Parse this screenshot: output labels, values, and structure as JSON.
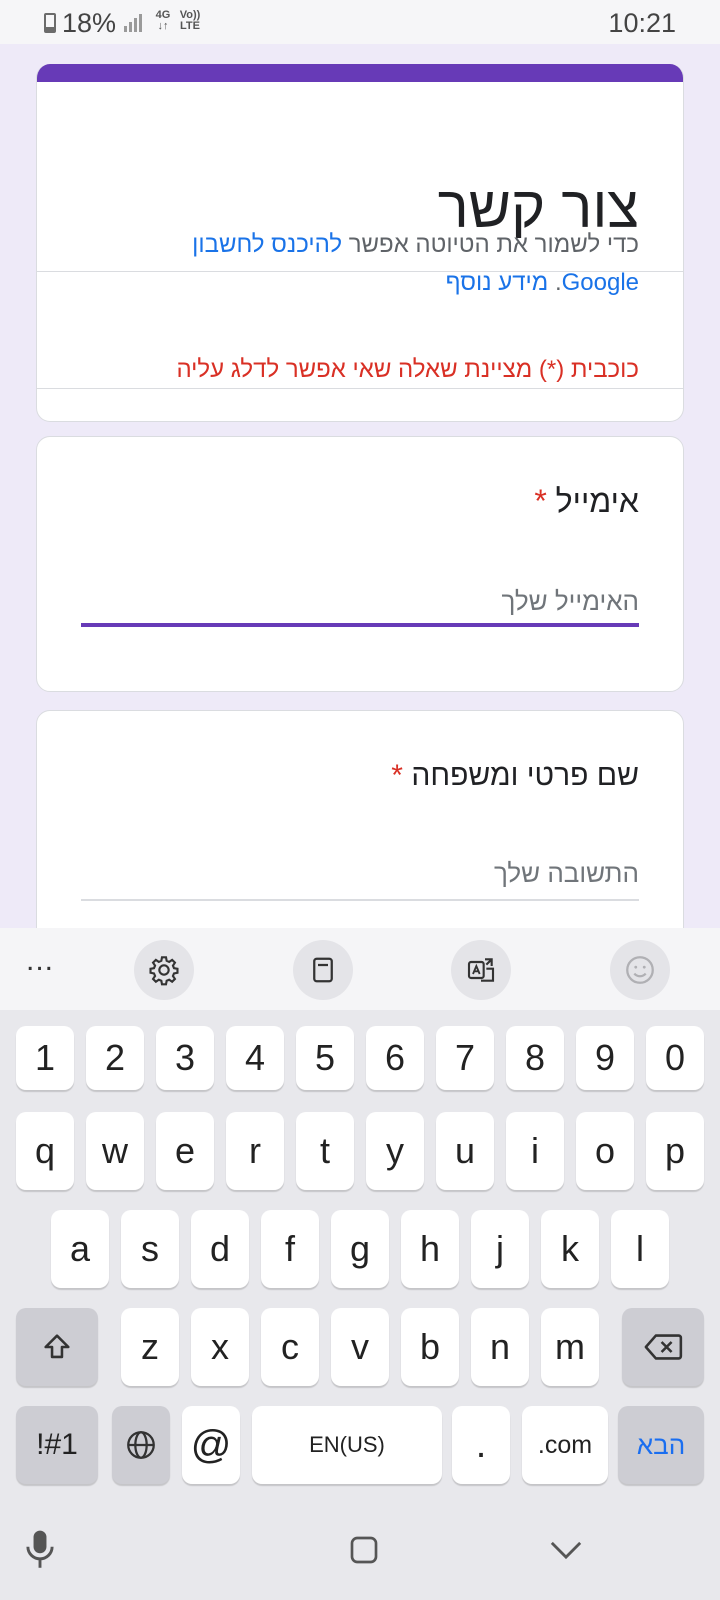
{
  "status_bar": {
    "battery": "18%",
    "network": "4G",
    "volte": "Vo)) LTE",
    "time": "10:21"
  },
  "form": {
    "accent_color": "#673ab7",
    "title": "צור קשר",
    "draft_text": "כדי לשמור את הטיוטה אפשר",
    "draft_link": "להיכנס לחשבון Google",
    "draft_period": ".",
    "learn_more": "מידע נוסף",
    "required_note": "כוכבית (*) מציינת שאלה שאי אפשר לדלג עליה",
    "questions": [
      {
        "label": "אימייל",
        "required_mark": "*",
        "placeholder": "האימייל שלך"
      },
      {
        "label": "שם פרטי ומשפחה",
        "required_mark": "*",
        "placeholder": "התשובה שלך"
      }
    ]
  },
  "keyboard": {
    "toolbar": {
      "more": "...",
      "icons": [
        "settings-icon",
        "clipboard-icon",
        "translate-icon",
        "emoji-icon"
      ]
    },
    "rows": {
      "numbers": [
        "1",
        "2",
        "3",
        "4",
        "5",
        "6",
        "7",
        "8",
        "9",
        "0"
      ],
      "row1": [
        "q",
        "w",
        "e",
        "r",
        "t",
        "y",
        "u",
        "i",
        "o",
        "p"
      ],
      "row2": [
        "a",
        "s",
        "d",
        "f",
        "g",
        "h",
        "j",
        "k",
        "l"
      ],
      "row3": [
        "z",
        "x",
        "c",
        "v",
        "b",
        "n",
        "m"
      ]
    },
    "symbols_key": "!#1",
    "at_key": "@",
    "space_label": "EN(US)",
    "period_key": ".",
    "com_key": ".com",
    "next_key": "הבא"
  }
}
